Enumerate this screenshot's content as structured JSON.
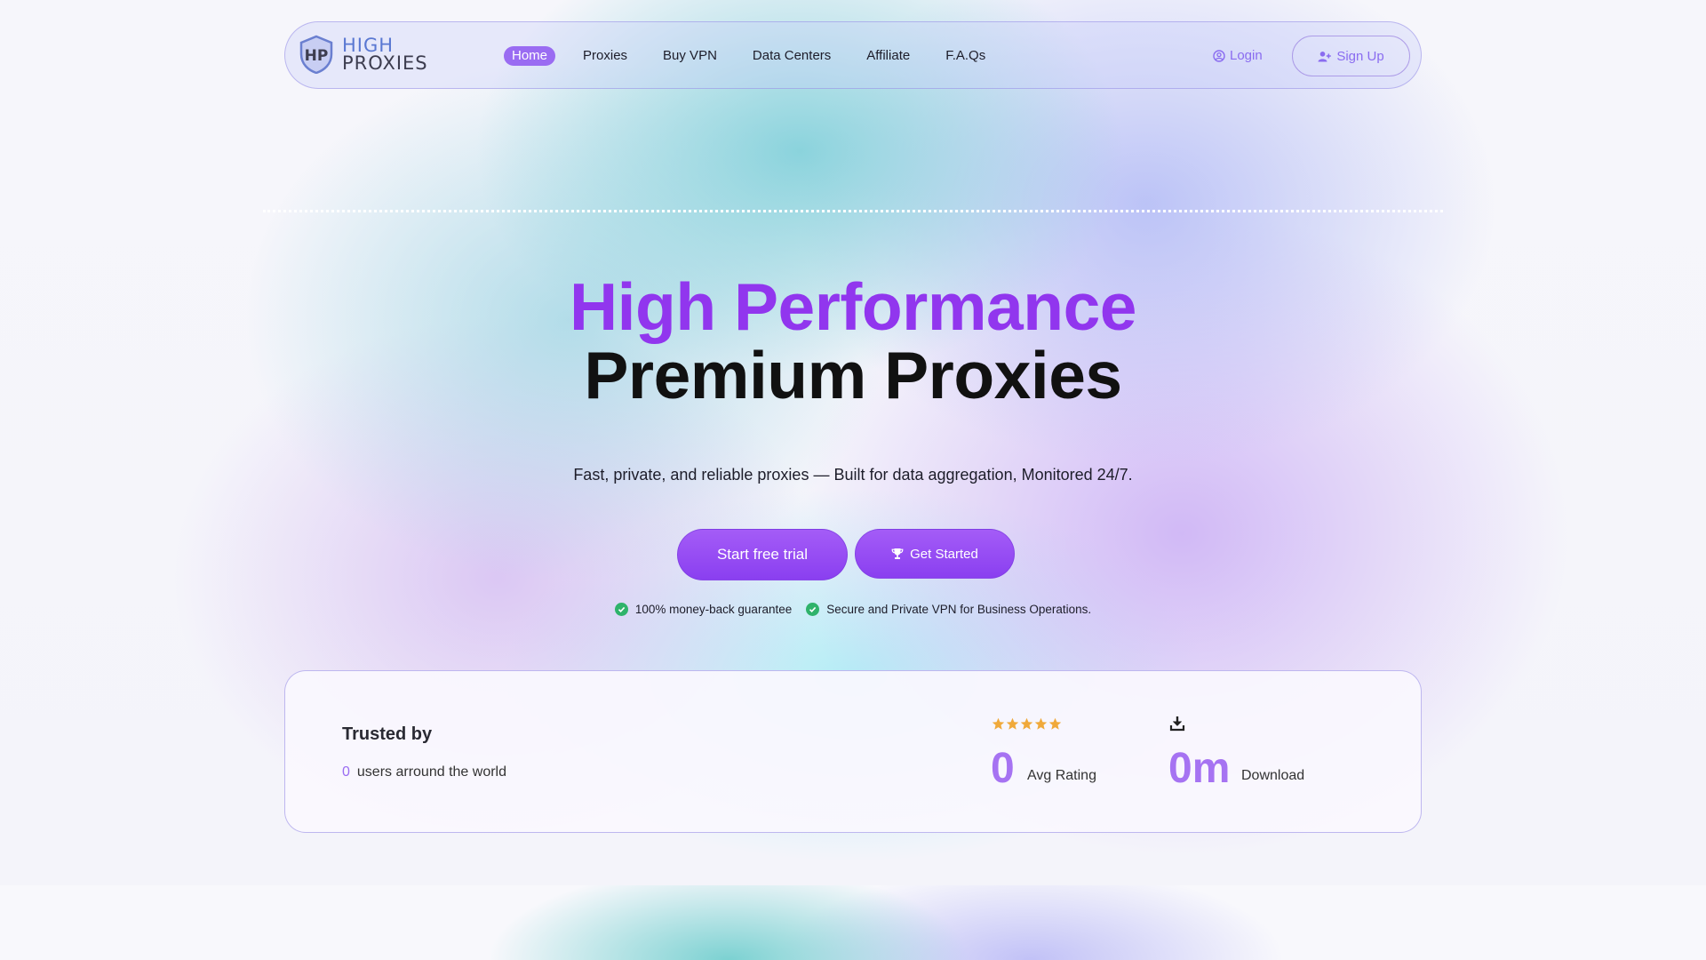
{
  "brand": {
    "logo_mark": "HP",
    "logo_word1": "HIGH",
    "logo_word2": "PROXIES"
  },
  "nav": {
    "items": [
      {
        "label": "Home",
        "active": true
      },
      {
        "label": "Proxies"
      },
      {
        "label": "Buy VPN"
      },
      {
        "label": "Data Centers"
      },
      {
        "label": "Affiliate"
      },
      {
        "label": "F.A.Qs"
      }
    ],
    "login_label": "Login",
    "signup_label": "Sign Up"
  },
  "hero": {
    "title_line1": "High Performance",
    "title_line2": "Premium Proxies",
    "subtitle": "Fast, private, and reliable proxies — Built for data aggregation, Monitored 24/7.",
    "primary_button": "Start free trial",
    "secondary_button": "Get Started",
    "checks": [
      "100% money-back guarantee",
      "Secure and Private VPN for Business Operations."
    ]
  },
  "trust": {
    "title": "Trusted by",
    "users_count": "0",
    "users_label": "users arround the world",
    "rating_stars": 5,
    "rating_value": "0",
    "rating_label": "Avg Rating",
    "downloads_value": "0m",
    "downloads_label": "Download"
  },
  "colors": {
    "accent": "#9136ee",
    "accent_soft": "#a673f2",
    "success": "#2fb36b",
    "star": "#f0a93a"
  },
  "icons": {
    "logo": "shield-icon",
    "login": "user-circle-icon",
    "signup": "user-plus-icon",
    "get_started": "trophy-icon",
    "check": "check-circle-icon",
    "download": "download-icon",
    "rating": "star-icon"
  }
}
